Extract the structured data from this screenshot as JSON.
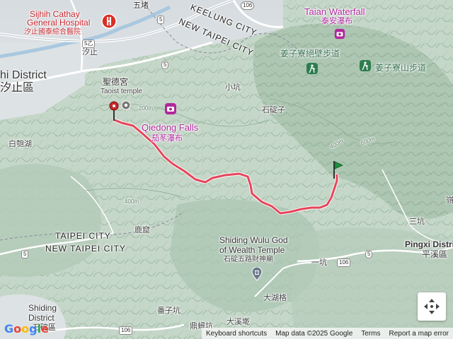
{
  "map": {
    "labels": {
      "sijhi_district": "hi District",
      "sijhi_zh": "汐止區",
      "hospital_en_1": "Sijhih Cathay",
      "hospital_en_2": "General Hospital",
      "hospital_zh": "汐止國泰綜合醫院",
      "wudu": "五堵",
      "keelung_city": "KEELUNG CITY",
      "new_taipei_city_top": "NEW TAIPEI CITY",
      "sijhi_zh_small": "汐止",
      "taoist_zh": "聖德宮",
      "taoist_en": "Taoist temple",
      "qiedong_en": "Qiedong Falls",
      "qiedong_zh": "茄苳瀑布",
      "baichihu": "白匏湖",
      "xiaokeng": "小坑",
      "shidingzi": "石碇子",
      "taian_en": "Taian Waterfall",
      "taian_zh": "泰安瀑布",
      "jiangziliao_trail": "姜子寮絕壁步道",
      "jiangziliao_mtn": "姜子寮山步道",
      "taipei_city": "TAIPEI CITY",
      "new_taipei_city_bottom": "NEW TAIPEI CITY",
      "luku": "鹿窟",
      "wulu_en_1": "Shiding Wulu God",
      "wulu_en_2": "of Wealth Temple",
      "wulu_zh": "石碇五路財神廟",
      "dahuge": "大湖格",
      "yikeng": "一坑",
      "sankeng": "三坑",
      "pingxi_en": "Pingxi District",
      "pingxi_zh": "平溪區",
      "shiding_en_1": "Shiding",
      "shiding_en_2": "District",
      "shiding_zh": "石碇區",
      "fanzikeng": "番子坑",
      "dingxikeng": "鼎蟳坑",
      "daxikeng": "大溪墘",
      "right_edge_zh": "嶺"
    },
    "shields": {
      "r5_top": "5",
      "r5a": "5乙",
      "r5_mid": "5",
      "r5_left": "5",
      "r5_right": "5",
      "r106_a": "106",
      "r106_b": "106",
      "r106_c": "106"
    },
    "contours": {
      "c200a": "200m",
      "c400a": "400m",
      "c400b": "400m",
      "c600": "600m"
    },
    "colors": {
      "route": "#e7445a",
      "start_marker": "#c62828",
      "end_marker": "#1e8e3e",
      "poi": "#b0289c",
      "hospital": "#d93025",
      "trail": "#2e7d4f"
    },
    "markers": {
      "start_icon": "red-pin-icon",
      "end_icon": "green-flag-icon"
    }
  },
  "controls": {
    "compass_icon": "compass-arrows-icon"
  },
  "footer": {
    "logo": "Google",
    "keyboard": "Keyboard shortcuts",
    "mapdata": "Map data ©2025 Google",
    "terms": "Terms",
    "report": "Report a map error"
  }
}
